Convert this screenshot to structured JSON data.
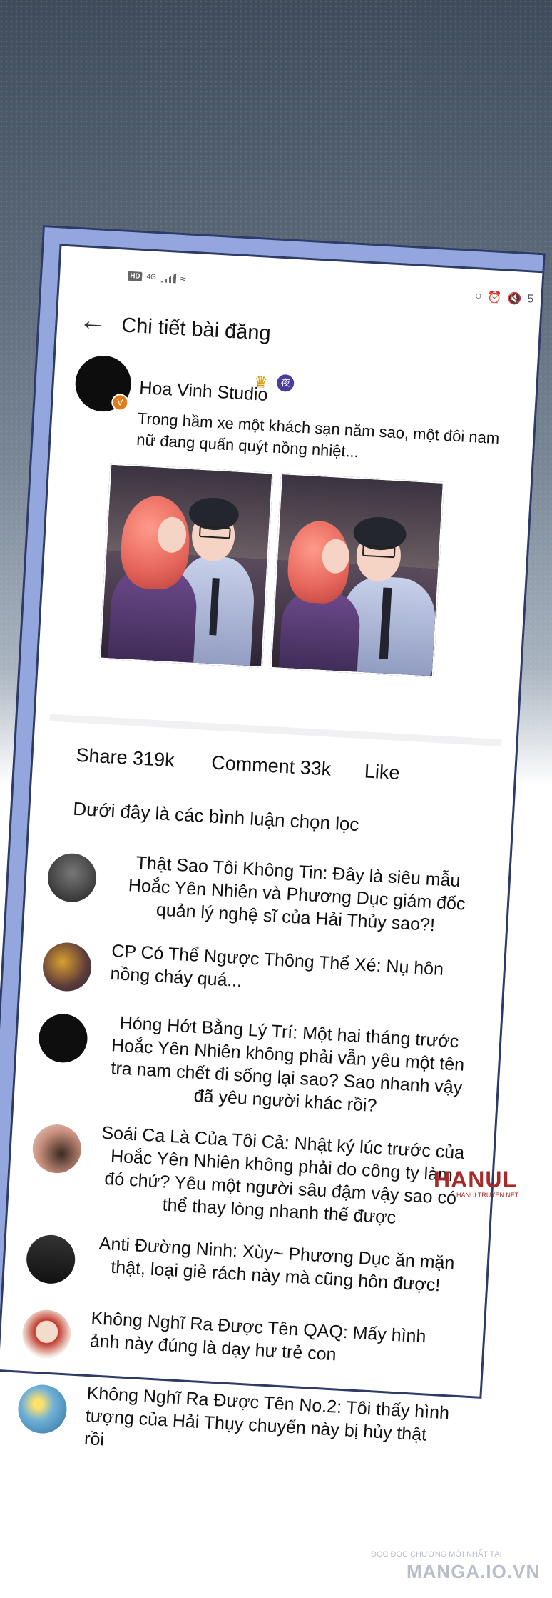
{
  "status": {
    "hd": "HD",
    "network": "4G",
    "battery_text": "5"
  },
  "header": {
    "title": "Chi tiết bài đăng"
  },
  "post": {
    "author": "Hoa Vinh Studio",
    "night_badge": "夜",
    "text": "Trong hầm xe một khách sạn năm sao, một đôi nam nữ đang quấn quýt nồng nhiệt..."
  },
  "actions": {
    "share": "Share 319k",
    "comment": "Comment 33k",
    "like": "Like"
  },
  "section_label": "Dưới đây là các bình luận chọn lọc",
  "comments": [
    {
      "text": "Thật Sao Tôi Không Tin: Đây là siêu mẫu Hoắc Yên Nhiên và Phương Dục giám đốc quản lý nghệ sĩ của Hải Thủy sao?!"
    },
    {
      "text": "CP Có Thể Ngược Thông Thể Xé: Nụ hôn nồng cháy quá..."
    },
    {
      "text": "Hóng Hớt Bằng Lý Trí: Một hai tháng trước Hoắc Yên Nhiên không phải vẫn yêu một tên tra nam chết đi sống lại sao? Sao nhanh vậy đã yêu người khác rồi?"
    },
    {
      "text": "Soái Ca Là Của Tôi Cả: Nhật ký lúc trước của Hoắc Yên Nhiên không phải do công ty làm đó chứ? Yêu một người sâu đậm vậy sao có thể thay lòng nhanh thế được"
    },
    {
      "text": "Anti Đường Ninh: Xùy~ Phương Dục ăn mặn thật, loại giẻ rách này mà cũng hôn được!"
    },
    {
      "text": "Không Nghĩ Ra Được Tên QAQ: Mấy hình ảnh này đúng là dạy hư trẻ con"
    },
    {
      "text": "Không Nghĩ Ra Được Tên No.2: Tôi thấy hình tượng của Hải Thụy chuyển này bị hủy thật rồi"
    }
  ],
  "watermark": {
    "main": "HANUL",
    "sub": "HANULTRUYEN.NET"
  },
  "footer": {
    "small": "ĐỌC ĐỌC CHƯƠNG MỚI NHẤT TẠI",
    "big": "MANGA.IO.VN"
  }
}
